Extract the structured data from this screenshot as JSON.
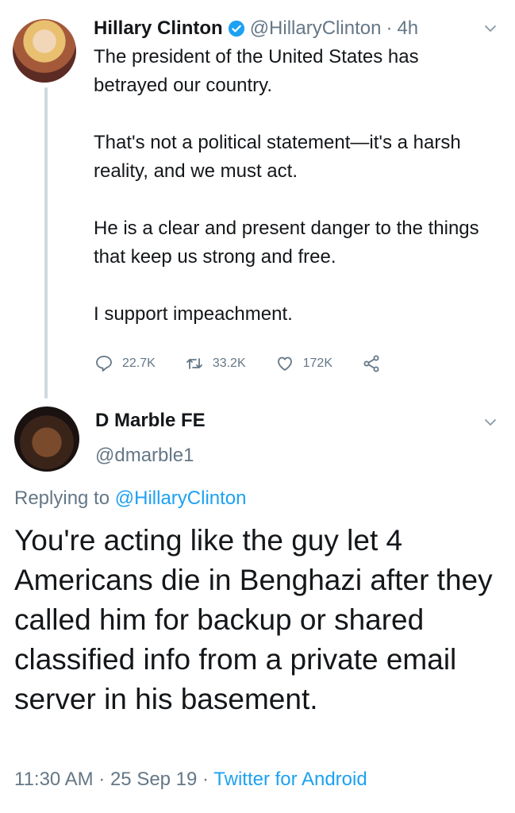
{
  "tweet": {
    "author_name": "Hillary Clinton",
    "handle": "@HillaryClinton",
    "separator": "·",
    "time": "4h",
    "paragraphs": [
      "The president of the United States has betrayed our country.",
      "That's not a political statement—it's a harsh reality, and we must act.",
      "He is a clear and present danger to the things that keep us strong and free.",
      "I support impeachment."
    ],
    "stats": {
      "replies": "22.7K",
      "retweets": "33.2K",
      "likes": "172K"
    }
  },
  "reply": {
    "author_name": "D Marble FE",
    "handle": "@dmarble1",
    "replying_prefix": "Replying to",
    "replying_to": "@HillaryClinton",
    "body": "You're acting like the guy let 4 Americans die in Benghazi after they called him for backup or shared classified info from a private email server in his basement.",
    "timestamp": "11:30 AM · 25 Sep 19 ·",
    "source": "Twitter for Android"
  },
  "colors": {
    "link": "#1da1f2",
    "muted": "#657786",
    "text": "#14171a",
    "verified": "#1da1f2"
  },
  "icons": [
    "verified-badge-icon",
    "chevron-down-icon",
    "reply-icon",
    "retweet-icon",
    "like-icon",
    "share-icon"
  ]
}
